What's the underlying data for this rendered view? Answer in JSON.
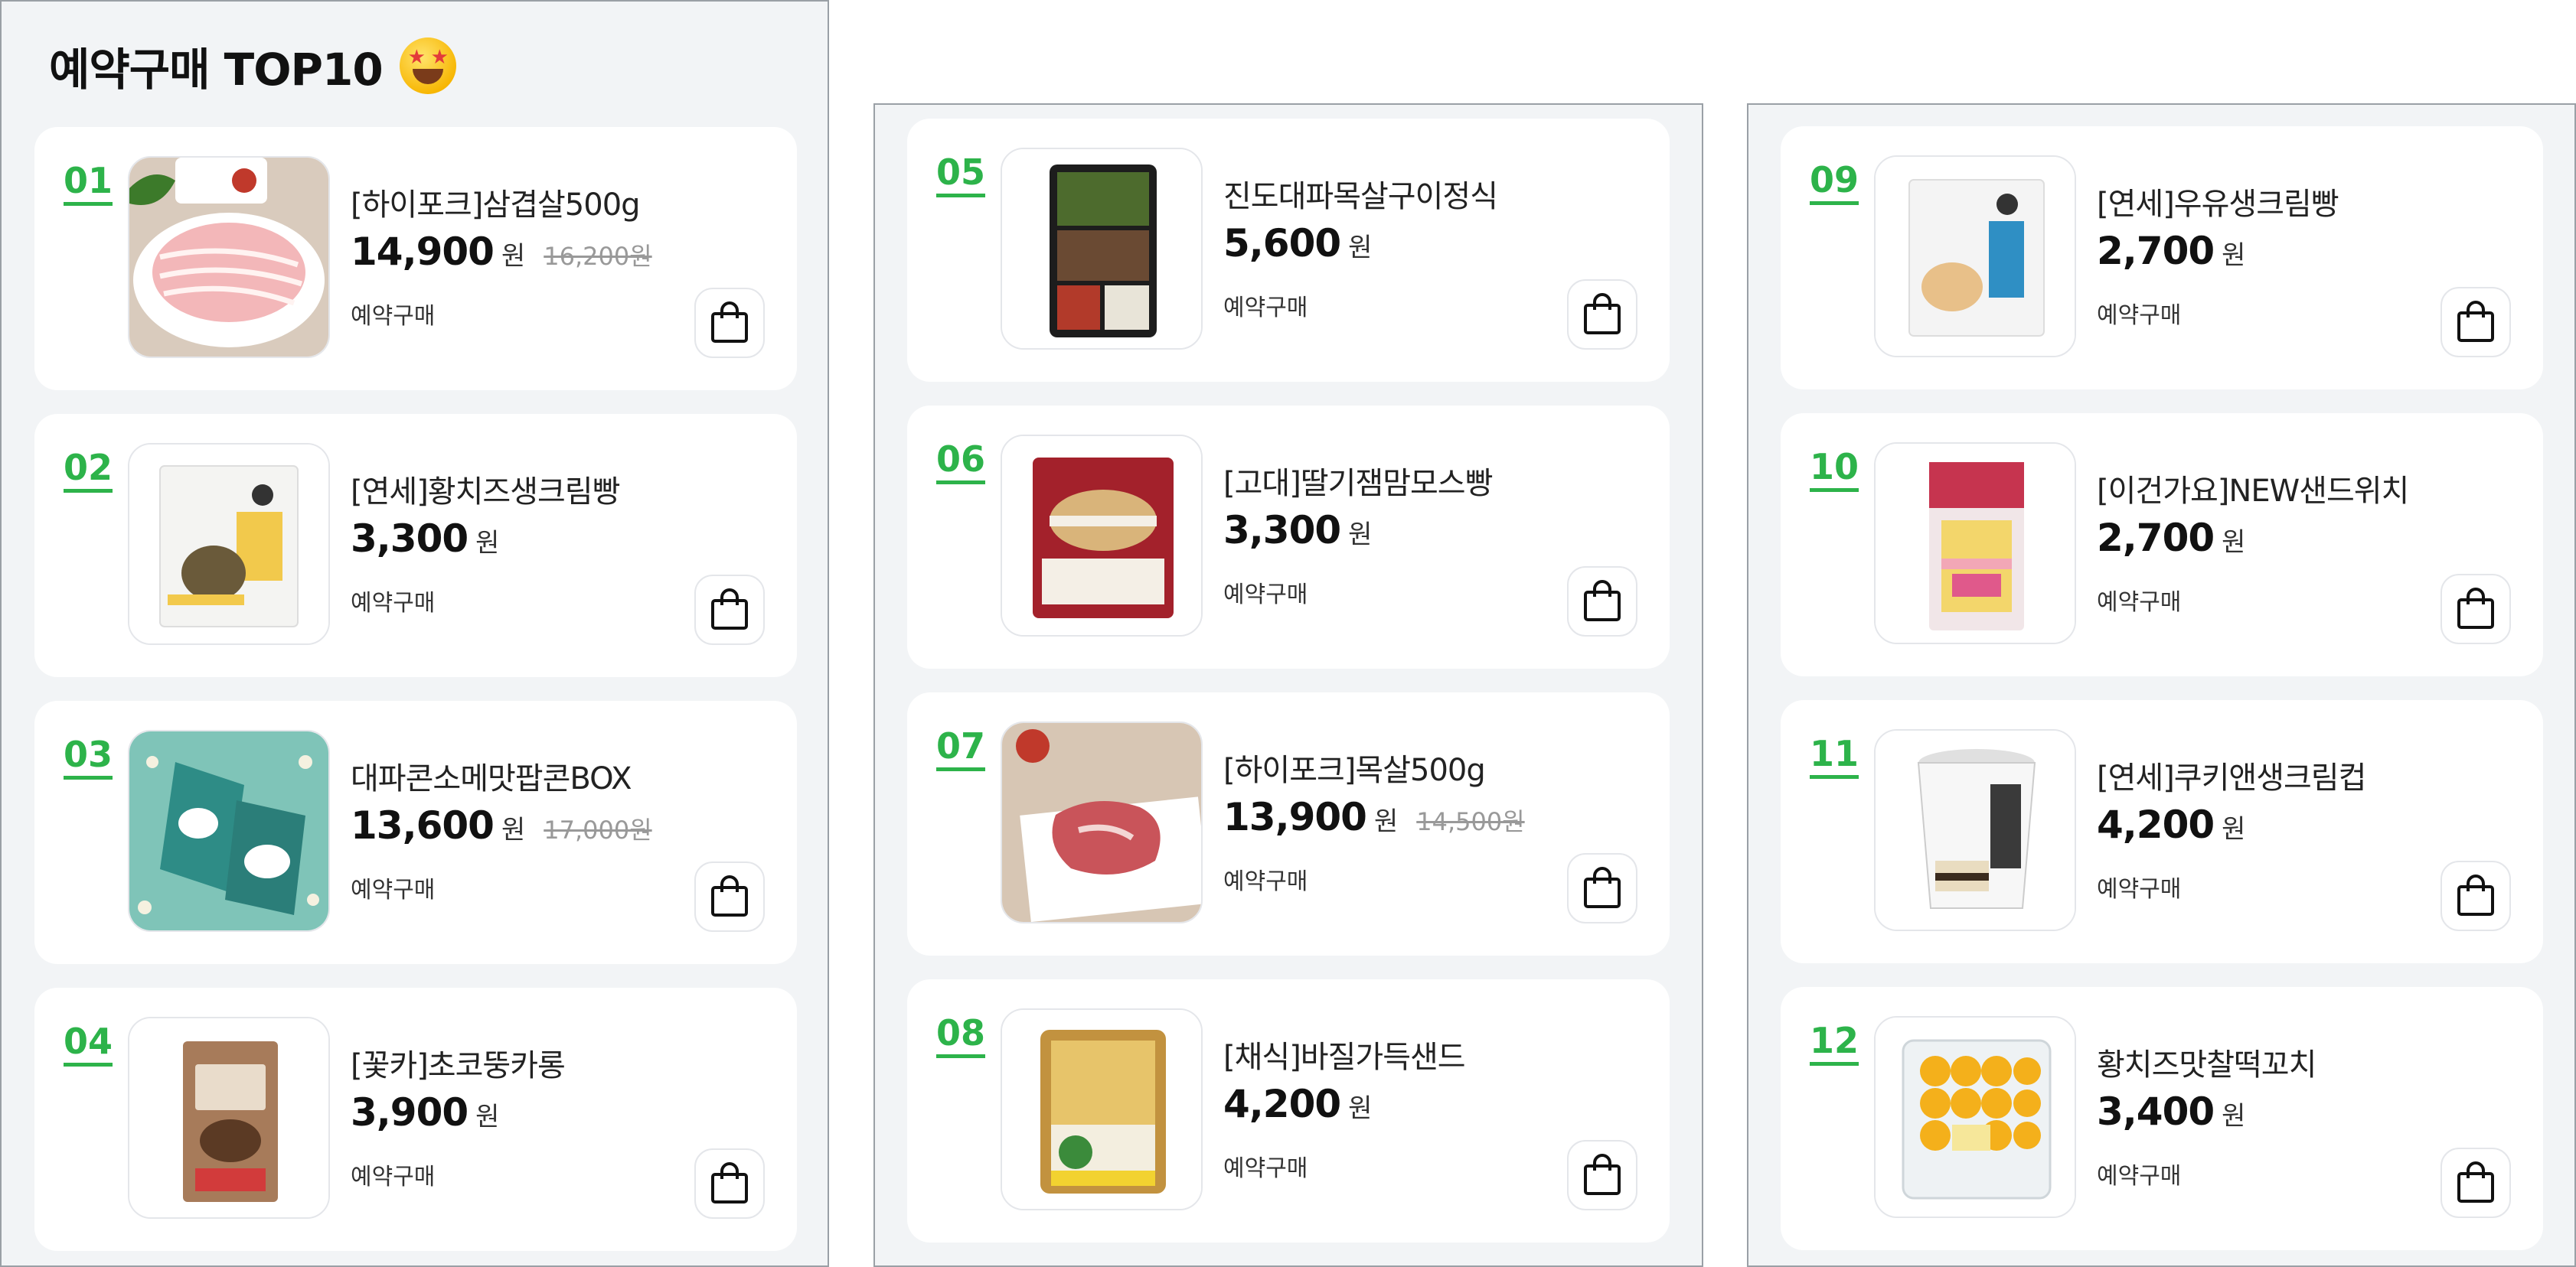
{
  "heading": {
    "title": "예약구매 TOP10",
    "emoji_icon": "star-struck-emoji-icon"
  },
  "colors": {
    "accent": "#2db34a",
    "panel_bg": "#f2f4f6",
    "card_bg": "#ffffff"
  },
  "products": [
    {
      "rank": "01",
      "name": "[하이포크]삼겹살500g",
      "price": "14,900",
      "unit": "원",
      "original_price": "16,200원",
      "tag": "예약구매",
      "image": "pork-belly-image"
    },
    {
      "rank": "02",
      "name": "[연세]황치즈생크림빵",
      "price": "3,300",
      "unit": "원",
      "original_price": "",
      "tag": "예약구매",
      "image": "cheese-cream-bread-image"
    },
    {
      "rank": "03",
      "name": "대파콘소메맛팝콘BOX",
      "price": "13,600",
      "unit": "원",
      "original_price": "17,000원",
      "tag": "예약구매",
      "image": "popcorn-box-image"
    },
    {
      "rank": "04",
      "name": "[꽃카]초코뚱카롱",
      "price": "3,900",
      "unit": "원",
      "original_price": "",
      "tag": "예약구매",
      "image": "choco-macaron-image"
    },
    {
      "rank": "05",
      "name": "진도대파목살구이정식",
      "price": "5,600",
      "unit": "원",
      "original_price": "",
      "tag": "예약구매",
      "image": "lunchbox-image"
    },
    {
      "rank": "06",
      "name": "[고대]딸기잼맘모스빵",
      "price": "3,300",
      "unit": "원",
      "original_price": "",
      "tag": "예약구매",
      "image": "strawberry-mammoth-bread-image"
    },
    {
      "rank": "07",
      "name": "[하이포크]목살500g",
      "price": "13,900",
      "unit": "원",
      "original_price": "14,500원",
      "tag": "예약구매",
      "image": "pork-neck-image"
    },
    {
      "rank": "08",
      "name": "[채식]바질가득샌드",
      "price": "4,200",
      "unit": "원",
      "original_price": "",
      "tag": "예약구매",
      "image": "basil-sandwich-image"
    },
    {
      "rank": "09",
      "name": "[연세]우유생크림빵",
      "price": "2,700",
      "unit": "원",
      "original_price": "",
      "tag": "예약구매",
      "image": "milk-cream-bread-image"
    },
    {
      "rank": "10",
      "name": "[이건가요]NEW샌드위치",
      "price": "2,700",
      "unit": "원",
      "original_price": "",
      "tag": "예약구매",
      "image": "sandwich-image"
    },
    {
      "rank": "11",
      "name": "[연세]쿠키앤생크림컵",
      "price": "4,200",
      "unit": "원",
      "original_price": "",
      "tag": "예약구매",
      "image": "cookie-cream-cup-image"
    },
    {
      "rank": "12",
      "name": "황치즈맛찰떡꼬치",
      "price": "3,400",
      "unit": "원",
      "original_price": "",
      "tag": "예약구매",
      "image": "rice-cake-skewer-image"
    }
  ]
}
